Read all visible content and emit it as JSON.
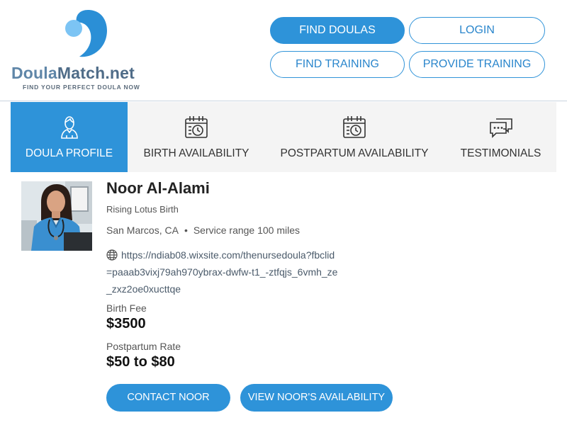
{
  "brand": {
    "name_part1": "Doula",
    "name_part2": "Match.net",
    "tagline": "FIND YOUR PERFECT DOULA NOW",
    "color_primary": "#2e93d9"
  },
  "nav": {
    "find_doulas": "FIND DOULAS",
    "login": "LOGIN",
    "find_training": "FIND TRAINING",
    "provide_training": "PROVIDE TRAINING"
  },
  "tabs": [
    {
      "label": "DOULA PROFILE",
      "icon": "person-icon",
      "active": true
    },
    {
      "label": "BIRTH AVAILABILITY",
      "icon": "calendar-clock-icon",
      "active": false
    },
    {
      "label": "POSTPARTUM AVAILABILITY",
      "icon": "calendar-clock-icon",
      "active": false
    },
    {
      "label": "TESTIMONIALS",
      "icon": "chat-bubbles-icon",
      "active": false
    }
  ],
  "profile": {
    "name": "Noor Al-Alami",
    "business": "Rising Lotus Birth",
    "location": "San Marcos, CA",
    "service_range": "Service range 100 miles",
    "website": "https://ndiab08.wixsite.com/thenursedoula?fbclid=paaab3vixj79ah970ybrax-dwfw-t1_-ztfqjs_6vmh_ze_zxz2oe0xucttqe",
    "birth_fee_label": "Birth Fee",
    "birth_fee": "$3500",
    "postpartum_label": "Postpartum Rate",
    "postpartum_rate": "$50 to $80"
  },
  "actions": {
    "contact": "CONTACT NOOR",
    "availability": "VIEW NOOR'S AVAILABILITY"
  }
}
